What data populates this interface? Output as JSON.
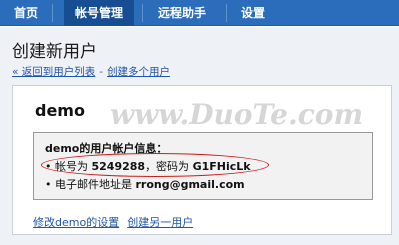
{
  "nav": {
    "tabs": [
      {
        "label": "首页"
      },
      {
        "label": "帐号管理"
      },
      {
        "label": "远程助手"
      },
      {
        "label": "设置"
      }
    ],
    "active_color": "#174e93",
    "bar_color": "#2b6dbb"
  },
  "page": {
    "title": "创建新用户",
    "back_link": "« 返回到用户列表",
    "dash": "-",
    "create_multiple_link": "创建多个用户"
  },
  "panel": {
    "username": "demo",
    "info_title": "demo的用户帐户信息：",
    "account_prefix": "• 帐号为 ",
    "account_number": "5249288",
    "password_prefix": "，密码为 ",
    "password_value": "G1FHicLk",
    "email_prefix": "• 电子邮件地址是 ",
    "email_value": "rrong@gmail.com",
    "edit_link": "修改demo的设置",
    "create_another_link": "创建另一用户",
    "highlight_color": "#cc1a1a"
  },
  "watermark": {
    "text": "www.DuoTe.com"
  }
}
